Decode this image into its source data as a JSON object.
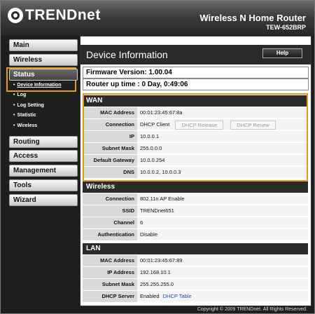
{
  "header": {
    "brand": "TRENDnet",
    "product": "Wireless N Home Router",
    "model": "TEW-652BRP"
  },
  "sidebar": {
    "items": [
      {
        "label": "Main"
      },
      {
        "label": "Wireless"
      },
      {
        "label": "Status"
      },
      {
        "label": "Routing"
      },
      {
        "label": "Access"
      },
      {
        "label": "Management"
      },
      {
        "label": "Tools"
      },
      {
        "label": "Wizard"
      }
    ],
    "status_sub": [
      {
        "label": "Device Information"
      },
      {
        "label": "Log"
      },
      {
        "label": "Log Setting"
      },
      {
        "label": "Statistic"
      },
      {
        "label": "Wireless"
      }
    ]
  },
  "page": {
    "title": "Device Information",
    "help": "Help",
    "firmware": "Firmware Version: 1.00.04",
    "uptime": "Router up time :  0 Day, 0:49:06"
  },
  "wan": {
    "heading": "WAN",
    "mac_label": "MAC Address",
    "mac": "00:01:23:45:67:8a",
    "conn_label": "Connection",
    "conn": "DHCP Client",
    "release_btn": "DHCP Release",
    "renew_btn": "DHCP Renew",
    "ip_label": "IP",
    "ip": "10.0.0.1",
    "mask_label": "Subnet Mask",
    "mask": "255.0.0.0",
    "gw_label": "Default Gateway",
    "gw": "10.0.0.254",
    "dns_label": "DNS",
    "dns": "10.0.0.2, 10.0.0.3"
  },
  "wireless": {
    "heading": "Wireless",
    "conn_label": "Connection",
    "conn": "802.11n AP Enable",
    "ssid_label": "SSID",
    "ssid": "TRENDnet651",
    "channel_label": "Channel",
    "channel": "6",
    "auth_label": "Authentication",
    "auth": "Disable"
  },
  "lan": {
    "heading": "LAN",
    "mac_label": "MAC Address",
    "mac": "00:01:23:45:67:89",
    "ip_label": "IP Address",
    "ip": "192.168.10.1",
    "mask_label": "Subnet Mask",
    "mask": "255.255.255.0",
    "dhcp_label": "DHCP Server",
    "dhcp": "Enabled",
    "dhcp_table": "DHCP Table"
  },
  "footer": {
    "copyright": "Copyright © 2009 TRENDnet. All Rights Reserved."
  },
  "colors": {
    "highlight": "#e8961e",
    "link": "#1f4fa8",
    "header_bg": "#2b2b2b"
  },
  "icons": {
    "logo": "trendnet-eye-logo-icon"
  }
}
